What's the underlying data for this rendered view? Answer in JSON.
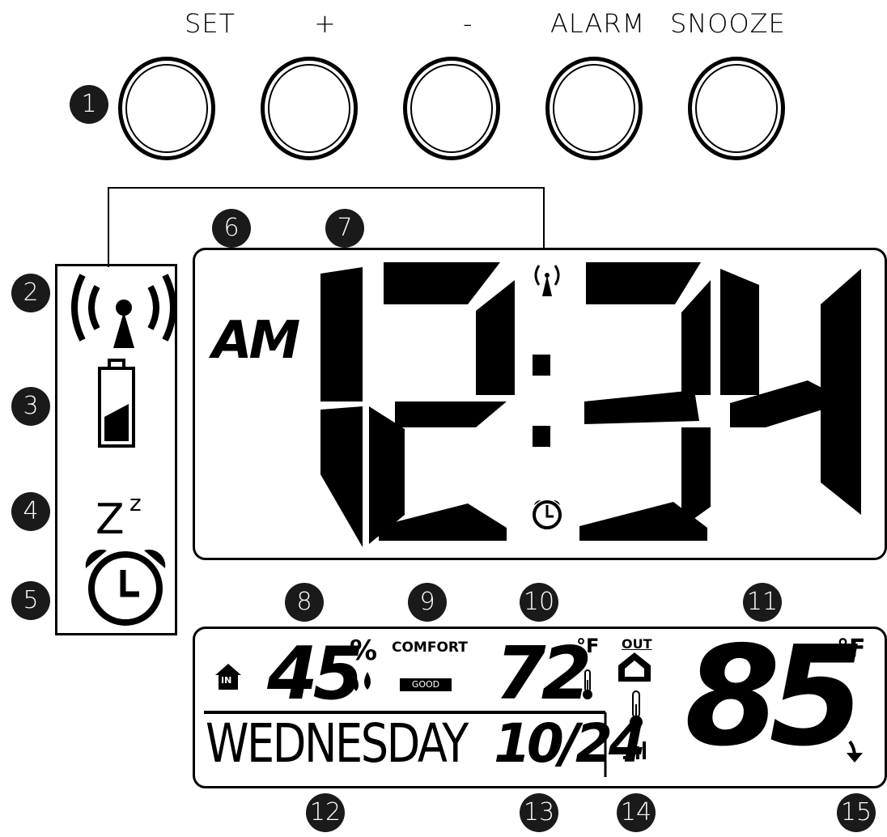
{
  "buttons": [
    {
      "label": "SET"
    },
    {
      "label": "+"
    },
    {
      "label": "-"
    },
    {
      "label": "ALARM"
    },
    {
      "label": "SNOOZE"
    }
  ],
  "callouts": [
    "1",
    "2",
    "3",
    "4",
    "5",
    "6",
    "7",
    "8",
    "9",
    "10",
    "11",
    "12",
    "13",
    "14",
    "15"
  ],
  "side_icons": {
    "snooze_text": "Z",
    "snooze_sup": "z"
  },
  "main_display": {
    "ampm": "AM",
    "hour": "12",
    "minute": "34"
  },
  "lower_display": {
    "indoor_badge": "IN",
    "humidity": "45",
    "humidity_unit": "%",
    "comfort_label": "COMFORT",
    "comfort_status": "GOOD",
    "indoor_temp": "72",
    "temp_unit": "°F",
    "day": "WEDNESDAY",
    "date": "10/24",
    "outdoor_label": "OUT",
    "outdoor_temp": "85",
    "outdoor_unit": "°F",
    "trend_icon": "arrow-down-icon"
  },
  "colors": {
    "ink": "#000000",
    "callout_bg": "#1a1a1a"
  }
}
